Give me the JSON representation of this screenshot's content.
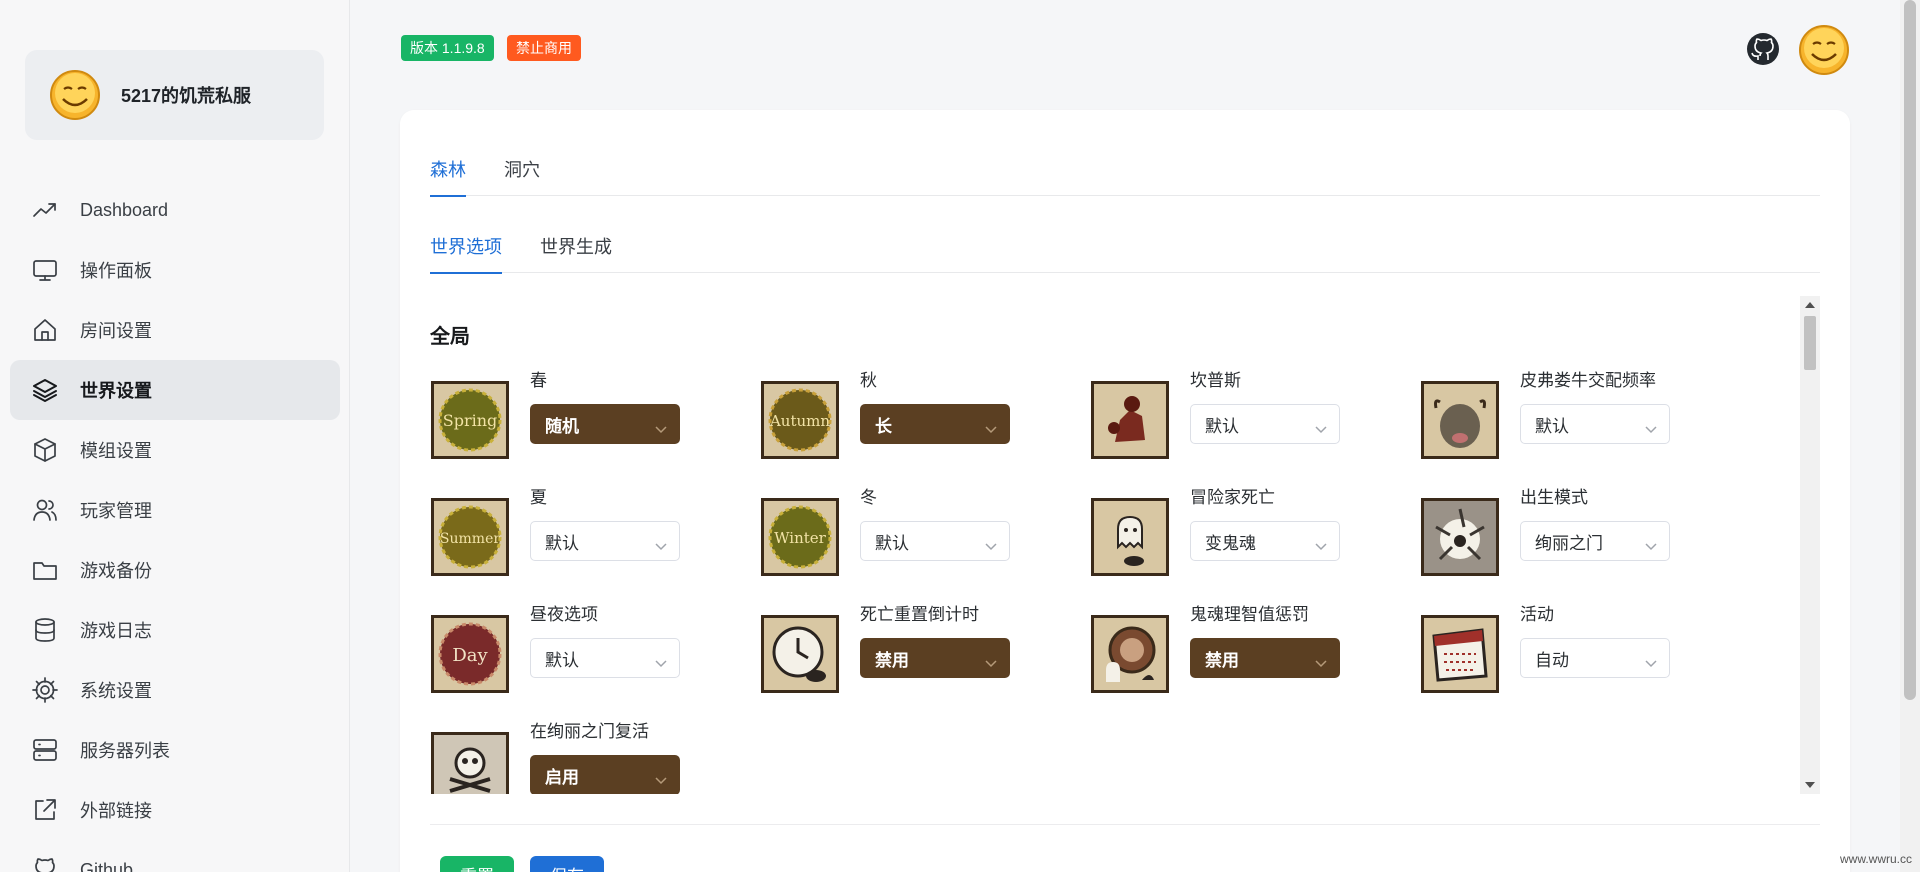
{
  "brand": {
    "name": "5217的饥荒私服"
  },
  "nav": {
    "items": [
      {
        "label": "Dashboard",
        "icon": "trend-icon"
      },
      {
        "label": "操作面板",
        "icon": "monitor-icon"
      },
      {
        "label": "房间设置",
        "icon": "home-icon"
      },
      {
        "label": "世界设置",
        "icon": "layers-icon",
        "active": true
      },
      {
        "label": "模组设置",
        "icon": "cube-icon"
      },
      {
        "label": "玩家管理",
        "icon": "users-icon"
      },
      {
        "label": "游戏备份",
        "icon": "folder-icon"
      },
      {
        "label": "游戏日志",
        "icon": "database-icon"
      },
      {
        "label": "系统设置",
        "icon": "gear-icon"
      },
      {
        "label": "服务器列表",
        "icon": "server-icon"
      },
      {
        "label": "外部链接",
        "icon": "external-link-icon"
      },
      {
        "label": "Github",
        "icon": "github-icon"
      }
    ]
  },
  "header": {
    "version": "版本 1.1.9.8",
    "notice": "禁止商用"
  },
  "tabs": {
    "forest": "森林",
    "caves": "洞穴"
  },
  "subtabs": {
    "world_options": "世界选项",
    "world_gen": "世界生成"
  },
  "section": {
    "title": "全局"
  },
  "settings": [
    {
      "label": "春",
      "value": "随机",
      "dark": true,
      "icon": "spring-icon"
    },
    {
      "label": "秋",
      "value": "长",
      "dark": true,
      "icon": "autumn-icon"
    },
    {
      "label": "坎普斯",
      "value": "默认",
      "dark": false,
      "icon": "krampus-icon"
    },
    {
      "label": "皮弗娄牛交配频率",
      "value": "默认",
      "dark": false,
      "icon": "beefalo-icon"
    },
    {
      "label": "夏",
      "value": "默认",
      "dark": false,
      "icon": "summer-icon"
    },
    {
      "label": "冬",
      "value": "默认",
      "dark": false,
      "icon": "winter-icon"
    },
    {
      "label": "冒险家死亡",
      "value": "变鬼魂",
      "dark": false,
      "icon": "ghost-icon"
    },
    {
      "label": "出生模式",
      "value": "绚丽之门",
      "dark": false,
      "icon": "portal-icon"
    },
    {
      "label": "昼夜选项",
      "value": "默认",
      "dark": false,
      "icon": "day-icon"
    },
    {
      "label": "死亡重置倒计时",
      "value": "禁用",
      "dark": true,
      "icon": "clock-icon"
    },
    {
      "label": "鬼魂理智值惩罚",
      "value": "禁用",
      "dark": true,
      "icon": "ghost-sanity-icon"
    },
    {
      "label": "活动",
      "value": "自动",
      "dark": false,
      "icon": "calendar-icon"
    },
    {
      "label": "在绚丽之门复活",
      "value": "启用",
      "dark": true,
      "icon": "skull-icon"
    }
  ],
  "icon_text": {
    "spring": "Spring",
    "autumn": "Autumn",
    "summer": "Summer",
    "winter": "Winter",
    "day": "Day"
  },
  "buttons": {
    "reset": "重置",
    "save": "保存"
  },
  "watermark": "www.wwru.cc",
  "colors": {
    "primary": "#1f6fd6",
    "success": "#18b566",
    "warning": "#ff5a1f",
    "brown": "#5b3f22"
  }
}
